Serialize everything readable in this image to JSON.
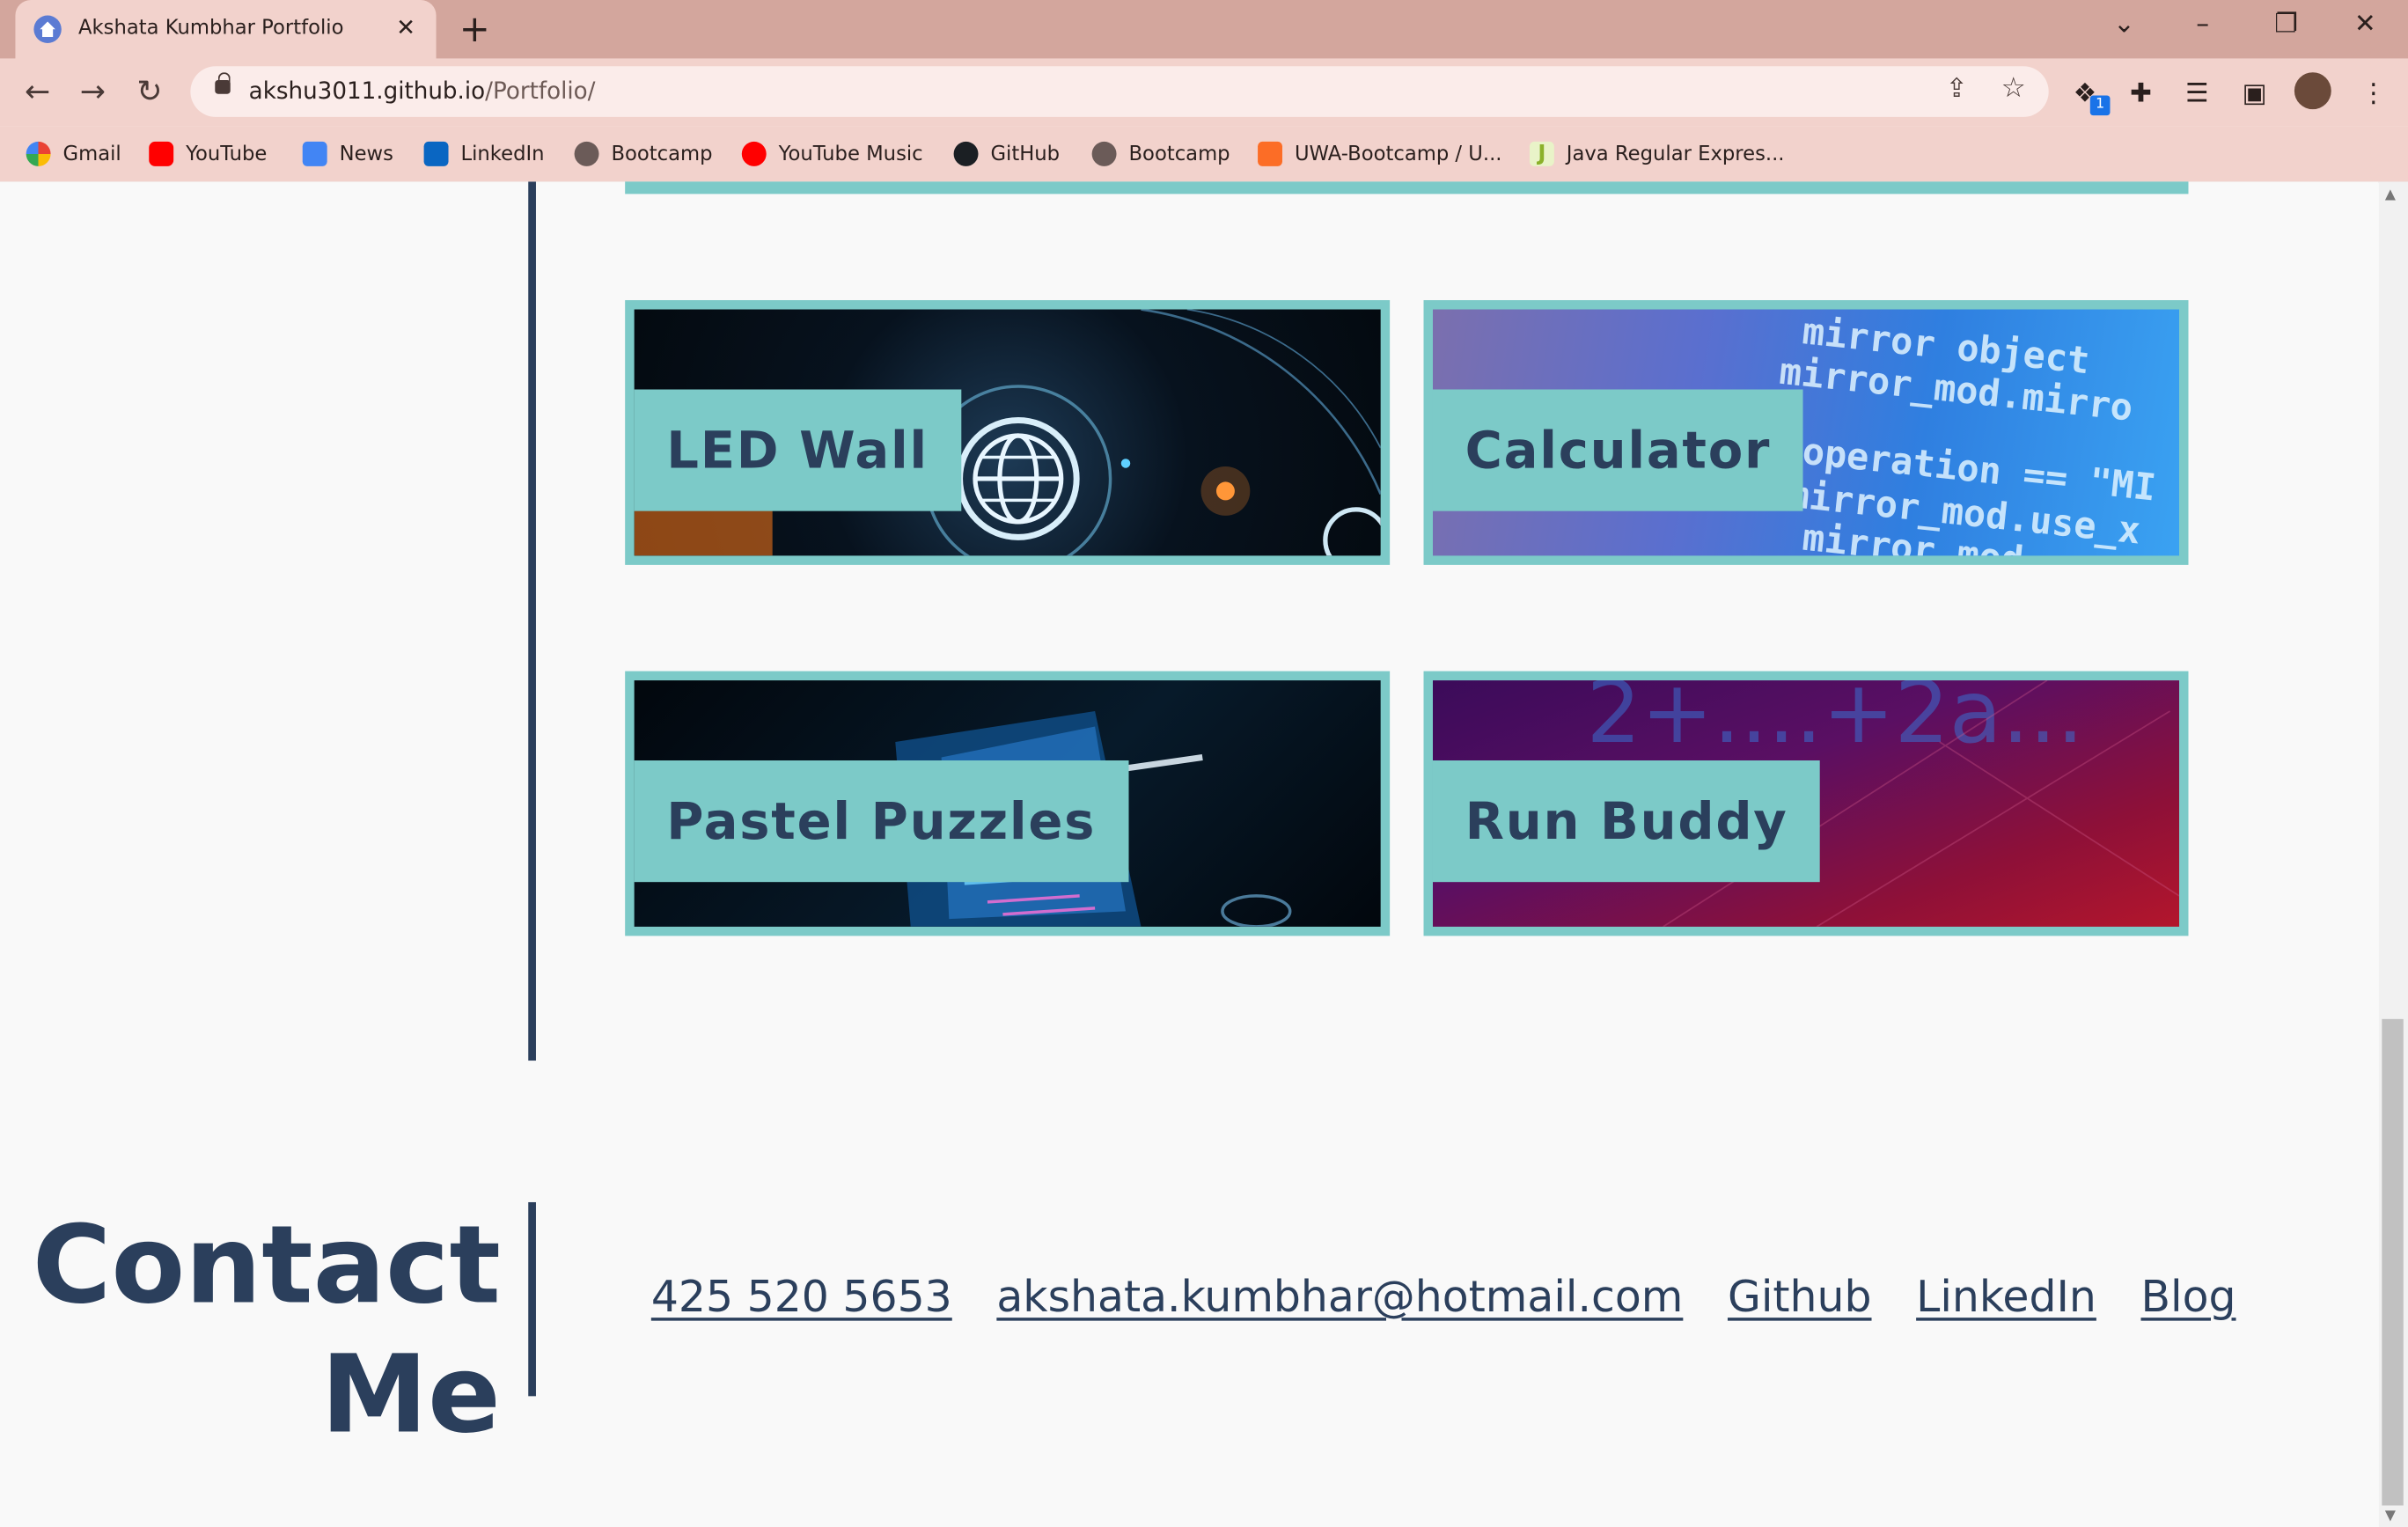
{
  "browser": {
    "tab_title": "Akshata Kumbhar Portfolio",
    "url_host": "akshu3011.github.io",
    "url_path": "/Portfolio/",
    "extension_badge": "1",
    "bookmarks": [
      {
        "label": "Gmail",
        "icon": "google-icon"
      },
      {
        "label": "YouTube",
        "icon": "youtube-icon"
      },
      {
        "label": "News",
        "icon": "news-icon"
      },
      {
        "label": "LinkedIn",
        "icon": "linkedin-icon"
      },
      {
        "label": "Bootcamp",
        "icon": "globe-icon"
      },
      {
        "label": "YouTube Music",
        "icon": "youtube-music-icon"
      },
      {
        "label": "GitHub",
        "icon": "github-icon"
      },
      {
        "label": "Bootcamp",
        "icon": "globe-icon"
      },
      {
        "label": "UWA-Bootcamp / U...",
        "icon": "gitlab-icon"
      },
      {
        "label": "Java Regular Expres...",
        "icon": "j-icon"
      }
    ]
  },
  "projects": [
    {
      "title": "LED Wall"
    },
    {
      "title": "Calculator"
    },
    {
      "title": "Pastel Puzzles"
    },
    {
      "title": "Run Buddy"
    }
  ],
  "contact": {
    "heading_line1": "Contact",
    "heading_line2": "Me",
    "phone": "425 520 5653",
    "email": "akshata.kumbhar@hotmail.com",
    "github": "Github",
    "linkedin": "LinkedIn",
    "blog": "Blog"
  },
  "colors": {
    "accent": "#7ccac8",
    "navy": "#2b3f5c",
    "chrome": "#f2d2cc"
  }
}
